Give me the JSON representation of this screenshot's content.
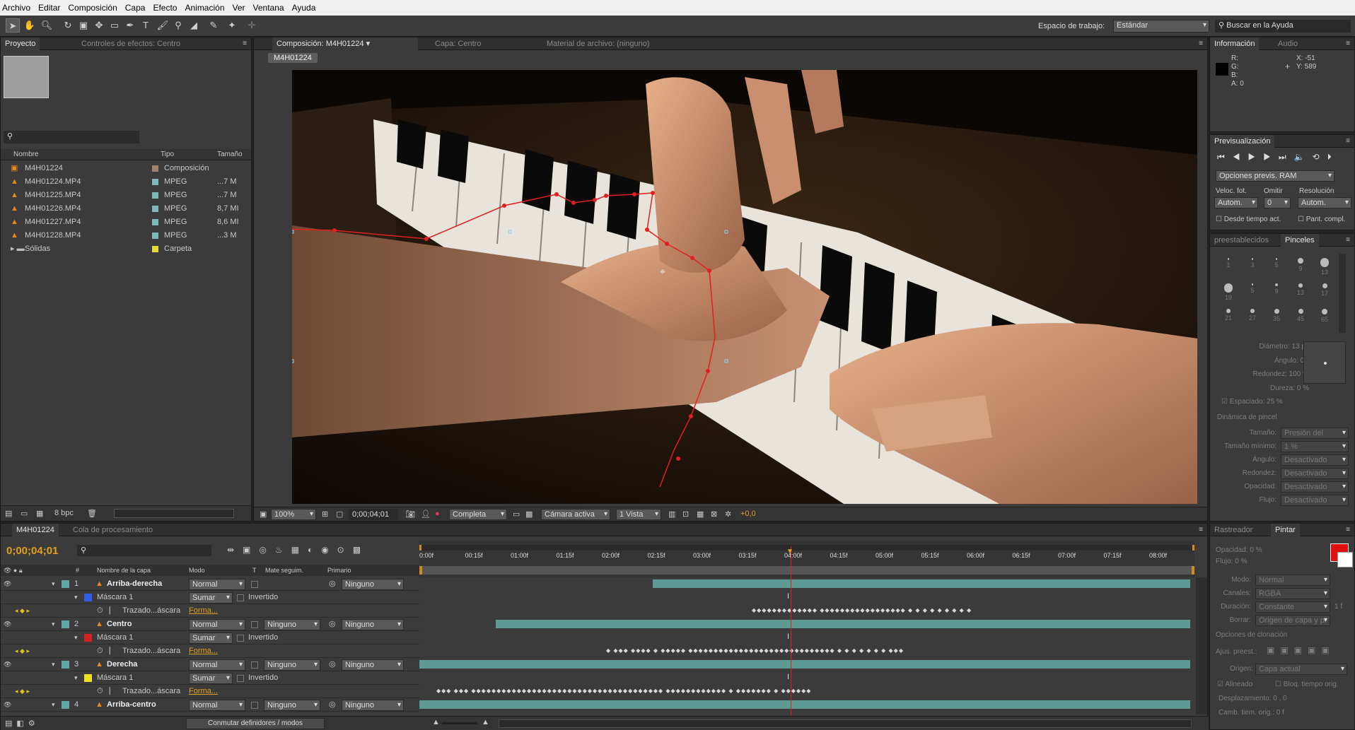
{
  "menu": [
    "Archivo",
    "Editar",
    "Composición",
    "Capa",
    "Efecto",
    "Animación",
    "Ver",
    "Ventana",
    "Ayuda"
  ],
  "workspace": {
    "label": "Espacio de trabajo:",
    "value": "Estándar",
    "search_placeholder": "Buscar en la Ayuda"
  },
  "project": {
    "tab": "Proyecto",
    "effects_tab": "Controles de efectos: Centro",
    "col_name": "Nombre",
    "col_type": "Tipo",
    "col_size": "Tamaño",
    "items": [
      {
        "name": "M4H01224",
        "type": "Composición",
        "size": "",
        "icon": "composition-icon",
        "color": "#a0846c"
      },
      {
        "name": "M4H01224.MP4",
        "type": "MPEG",
        "size": "...7 M",
        "icon": "vlc-file-icon",
        "color": "#7fb8b8"
      },
      {
        "name": "M4H01225.MP4",
        "type": "MPEG",
        "size": "...7 M",
        "icon": "vlc-file-icon",
        "color": "#7fb8b8"
      },
      {
        "name": "M4H01226.MP4",
        "type": "MPEG",
        "size": "8,7 MI",
        "icon": "vlc-file-icon",
        "color": "#7fb8b8"
      },
      {
        "name": "M4H01227.MP4",
        "type": "MPEG",
        "size": "8,6 MI",
        "icon": "vlc-file-icon",
        "color": "#7fb8b8"
      },
      {
        "name": "M4H01228.MP4",
        "type": "MPEG",
        "size": "...3 M",
        "icon": "vlc-file-icon",
        "color": "#7fb8b8"
      },
      {
        "name": "Sólidas",
        "type": "Carpeta",
        "size": "",
        "icon": "folder-icon",
        "color": "#e6d83a"
      }
    ],
    "bpc": "8 bpc"
  },
  "composition": {
    "tab": "Composición: M4H01224",
    "layer_tab": "Capa: Centro",
    "footage_tab": "Material de archivo: (ninguno)",
    "crumb": "M4H01224",
    "zoom": "100%",
    "timecode": "0;00;04;01",
    "resolution": "Completa",
    "camera": "Cámara activa",
    "views": "1 Vista",
    "exposure": "+0,0"
  },
  "info": {
    "tab": "Información",
    "audio_tab": "Audio",
    "r": "R:",
    "g": "G:",
    "b": "B:",
    "a": "A:  0",
    "x": "X:  -51",
    "y": "Y:  589"
  },
  "preview": {
    "tab": "Previsualización",
    "ram_options": "Opciones previs. RAM",
    "fps_label": "Veloc. fot.",
    "skip_label": "Omitir",
    "res_label": "Resolución",
    "fps": "Autom.",
    "skip": "0",
    "res": "Autom.",
    "from_current": "Desde tiempo act.",
    "fullscreen": "Pant. compl."
  },
  "brushes": {
    "presets_tab": "preestablecidos",
    "brushes_tab": "Pinceles",
    "sizes": [
      "1",
      "3",
      "5",
      "9",
      "13",
      "19",
      "5",
      "9",
      "13",
      "17",
      "21",
      "27",
      "35",
      "45",
      "65"
    ],
    "diameter": "Diámetro: 13 px",
    "angle": "Ángulo: 0 °",
    "roundness": "Redondez: 100 %",
    "hardness": "Dureza: 0 %",
    "spacing": "Espaciado: 25 %",
    "dynamics": "Dinámica de pincel",
    "dyn_rows": [
      {
        "label": "Tamaño:",
        "value": "Presión del"
      },
      {
        "label": "Tamaño mínimo:",
        "value": "1 %"
      },
      {
        "label": "Ángulo:",
        "value": "Desactivado"
      },
      {
        "label": "Redondez:",
        "value": "Desactivado"
      },
      {
        "label": "Opacidad:",
        "value": "Desactivado"
      },
      {
        "label": "Flujo:",
        "value": "Desactivado"
      }
    ]
  },
  "paint": {
    "tracker_tab": "Rastreador",
    "paint_tab": "Pintar",
    "opacity": "Opacidad: 0 %",
    "flow": "Flujo: 0 %",
    "mode_label": "Modo:",
    "mode": "Normal",
    "channels_label": "Canales:",
    "channels": "RGBA",
    "duration_label": "Duración:",
    "duration": "Constante",
    "duration_val": "1 f",
    "erase_label": "Borrar:",
    "erase": "Origen de capa y pi",
    "clone_options": "Opciones de clonación",
    "preset_label": "Ajus. preest.:",
    "source_label": "Origen:",
    "source": "Capa actual",
    "aligned": "Alineado",
    "lock_time": "Bloq. tiempo orig.",
    "offset": "Desplazamiento: 0 ,     0",
    "time_offset": "Camb. tiem. orig.: 0 f",
    "fg_color": "#e01010",
    "bg_color": "#ffffff"
  },
  "timeline": {
    "comp_tab": "M4H01224",
    "render_tab": "Cola de procesamiento",
    "timecode": "0;00;04;01",
    "col_layer_name": "Nombre de la capa",
    "col_mode": "Modo",
    "col_t": "T",
    "col_track": "Mate seguim.",
    "col_parent": "Primario",
    "ticks": [
      "0:00f",
      "00:15f",
      "01:00f",
      "01:15f",
      "02:00f",
      "02:15f",
      "03:00f",
      "03:15f",
      "04:00f",
      "04:15f",
      "05:00f",
      "05:15f",
      "06:00f",
      "06:15f",
      "07:00f",
      "07:15f",
      "08:00f"
    ],
    "switch_label": "Conmutar definidores / modos",
    "rows": [
      {
        "kind": "layer",
        "num": "1",
        "name": "Arriba-derecha",
        "mode": "Normal",
        "track": "",
        "parent": "Ninguno",
        "color": "#5fa6a6"
      },
      {
        "kind": "mask",
        "name": "Máscara 1",
        "mode": "Sumar",
        "inv": "Invertido",
        "color": "#2f5fe8"
      },
      {
        "kind": "path",
        "name": "Trazado...áscara",
        "value": "Forma..."
      },
      {
        "kind": "layer",
        "num": "2",
        "name": "Centro",
        "mode": "Normal",
        "track": "Ninguno",
        "parent": "Ninguno",
        "color": "#5fa6a6"
      },
      {
        "kind": "mask",
        "name": "Máscara 1",
        "mode": "Sumar",
        "inv": "Invertido",
        "color": "#d42020"
      },
      {
        "kind": "path",
        "name": "Trazado...áscara",
        "value": "Forma..."
      },
      {
        "kind": "layer",
        "num": "3",
        "name": "Derecha",
        "mode": "Normal",
        "track": "Ninguno",
        "parent": "Ninguno",
        "color": "#5fa6a6"
      },
      {
        "kind": "mask",
        "name": "Máscara 1",
        "mode": "Sumar",
        "inv": "Invertido",
        "color": "#f0e020"
      },
      {
        "kind": "path",
        "name": "Trazado...áscara",
        "value": "Forma..."
      },
      {
        "kind": "layer",
        "num": "4",
        "name": "Arriba-centro",
        "mode": "Normal",
        "track": "Ninguno",
        "parent": "Ninguno",
        "color": "#5fa6a6"
      }
    ]
  }
}
